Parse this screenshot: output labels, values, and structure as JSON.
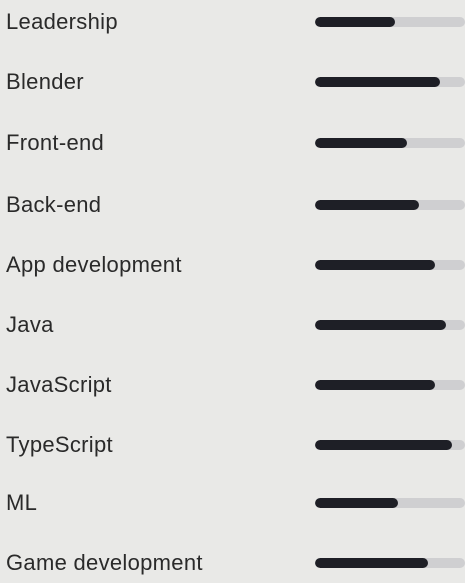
{
  "colors": {
    "background": "#e9e9e7",
    "text": "#2a2a2a",
    "bar_track": "#cfcfd1",
    "bar_fill": "#1e1f26"
  },
  "skills": [
    {
      "label": "Leadership",
      "level": 0.53
    },
    {
      "label": "Blender",
      "level": 0.83
    },
    {
      "label": "Front-end",
      "level": 0.61
    },
    {
      "label": "Back-end",
      "level": 0.69
    },
    {
      "label": "App development",
      "level": 0.8
    },
    {
      "label": "Java",
      "level": 0.87
    },
    {
      "label": "JavaScript",
      "level": 0.8
    },
    {
      "label": "TypeScript",
      "level": 0.91
    },
    {
      "label": "ML",
      "level": 0.55
    },
    {
      "label": "Game development",
      "level": 0.75
    }
  ]
}
